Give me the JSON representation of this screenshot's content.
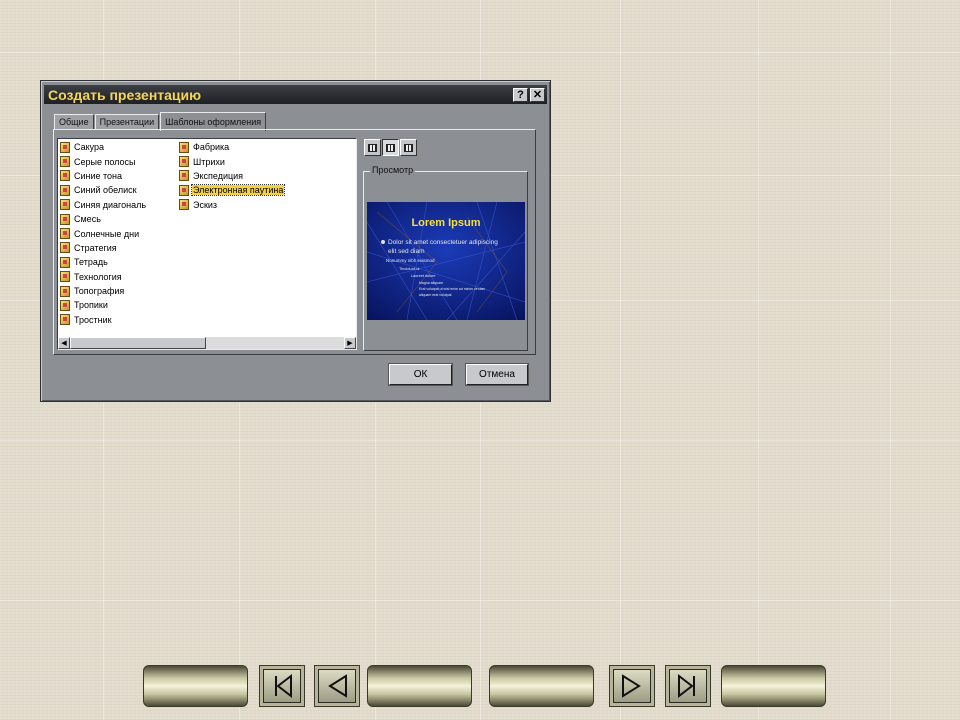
{
  "dialog": {
    "title": "Создать презентацию",
    "help_button": "?",
    "close_button": "✕",
    "tabs": [
      {
        "label": "Общие",
        "active": false
      },
      {
        "label": "Презентации",
        "active": false
      },
      {
        "label": "Шаблоны оформления",
        "active": true
      }
    ],
    "templates_col1": [
      "Сакура",
      "Серые полосы",
      "Синие тона",
      "Синий обелиск",
      "Синяя диагональ",
      "Смесь",
      "Солнечные дни",
      "Стратегия",
      "Тетрадь",
      "Технология",
      "Топография",
      "Тропики",
      "Тростник"
    ],
    "templates_col2": [
      "Фабрика",
      "Штрихи",
      "Экспедиция",
      "Электронная паутина",
      "Эскиз"
    ],
    "selected_template": "Электронная паутина",
    "view_buttons": [
      "large-icons-view-icon",
      "list-view-icon",
      "details-view-icon"
    ],
    "preview": {
      "label": "Просмотр",
      "slide_title": "Lorem Ipsum",
      "bullet1": "Dolor sit amet consectetuer adipiscing",
      "bullet1b": "elit sed diam",
      "bullet2": "Nonummy nibh euismod",
      "bullet3": "Tincidunt ut",
      "bullet4": "Laoreet dolore",
      "bullet5": "Magna aliquam",
      "bullet6": "Erat volutpat ut wisi enim ad minim veniam",
      "bullet7": "aliquam erat volutpat"
    },
    "ok_label": "ОК",
    "cancel_label": "Отмена"
  },
  "navigation": {
    "buttons": [
      "blank-nav-button",
      "first-slide-icon",
      "previous-slide-icon",
      "blank-nav-button",
      "blank-nav-button",
      "next-slide-icon",
      "last-slide-icon",
      "blank-nav-button"
    ]
  },
  "colors": {
    "title_text": "#f6d55a",
    "dialog_bg": "#8c9095",
    "selection": "#f2d04a",
    "preview_bg": "#0a1a7a",
    "slide_bg": "#e3dccd"
  }
}
